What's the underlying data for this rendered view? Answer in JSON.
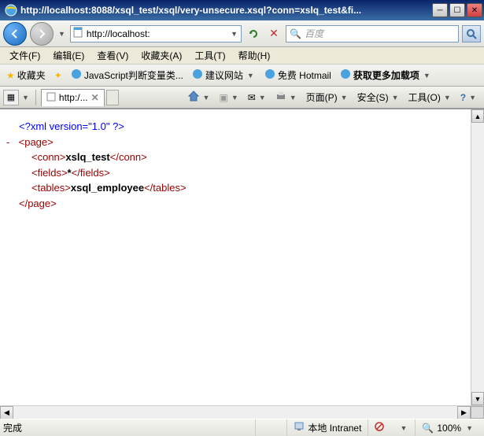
{
  "window": {
    "title": "http://localhost:8088/xsql_test/xsql/very-unsecure.xsql?conn=xslq_test&fi..."
  },
  "address": {
    "url": "http://localhost:"
  },
  "search": {
    "placeholder": "百度"
  },
  "menu": {
    "file": "文件(F)",
    "edit": "编辑(E)",
    "view": "查看(V)",
    "favorites": "收藏夹(A)",
    "tools": "工具(T)",
    "help": "帮助(H)"
  },
  "favbar": {
    "favorites": "收藏夹",
    "js_item": "JavaScript判断变量类...",
    "suggest": "建议网站",
    "hotmail": "免费 Hotmail",
    "more_addons": "获取更多加载项"
  },
  "tab": {
    "title": "http:/..."
  },
  "toolbar": {
    "page": "页面(P)",
    "safety": "安全(S)",
    "tools": "工具(O)"
  },
  "xml": {
    "decl": "<?xml version=\"1.0\" ?>",
    "page_open": "<page>",
    "page_close": "</page>",
    "conn_open": "<conn>",
    "conn_text": "xslq_test",
    "conn_close": "</conn>",
    "fields_open": "<fields>",
    "fields_text": "*",
    "fields_close": "</fields>",
    "tables_open": "<tables>",
    "tables_text": "xsql_employee",
    "tables_close": "</tables>"
  },
  "status": {
    "done": "完成",
    "zone": "本地 Intranet",
    "protected": "",
    "zoom": "100%"
  }
}
